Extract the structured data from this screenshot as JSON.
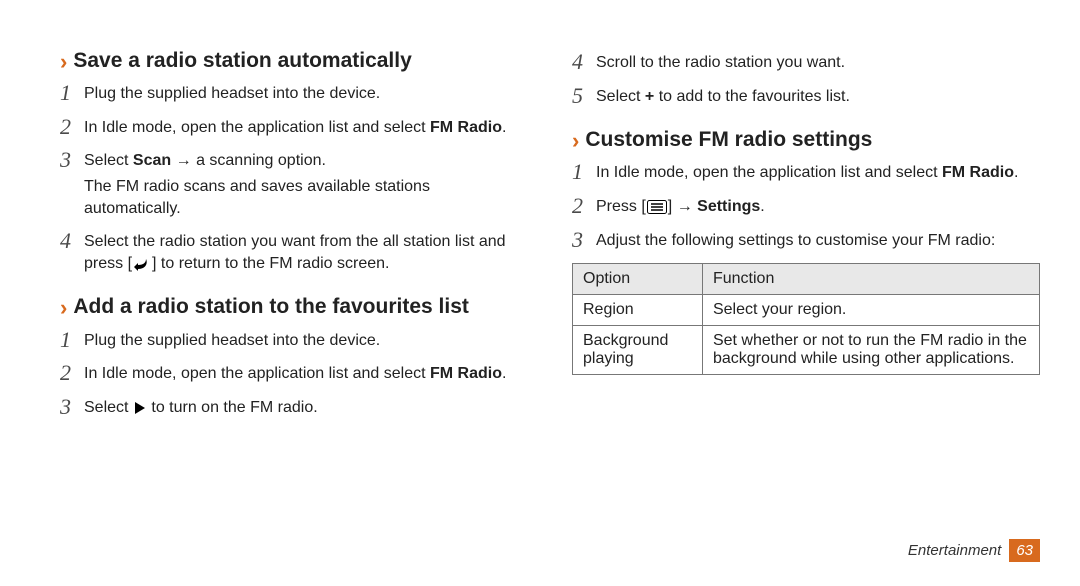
{
  "sections": {
    "save": {
      "title": "Save a radio station automatically",
      "steps": [
        {
          "n": "1",
          "lines": [
            "Plug the supplied headset into the device."
          ]
        },
        {
          "n": "2",
          "lines": [
            "In Idle mode, open the application list and select <b>FM Radio</b>."
          ]
        },
        {
          "n": "3",
          "lines": [
            "Select <b>Scan</b> → a scanning option.",
            "The FM radio scans and saves available stations automatically."
          ]
        },
        {
          "n": "4",
          "lines": [
            "Select the radio station you want from the all station list and press [BACK_ICON] to return to the FM radio screen."
          ]
        }
      ]
    },
    "fav": {
      "title": "Add a radio station to the favourites list",
      "steps": [
        {
          "n": "1",
          "lines": [
            "Plug the supplied headset into the device."
          ]
        },
        {
          "n": "2",
          "lines": [
            "In Idle mode, open the application list and select <b>FM Radio</b>."
          ]
        },
        {
          "n": "3",
          "lines": [
            "Select PLAY_ICON to turn on the FM radio."
          ]
        },
        {
          "n": "4",
          "lines": [
            "Scroll to the radio station you want."
          ]
        },
        {
          "n": "5",
          "lines": [
            "Select <b>+</b> to add to the favourites list."
          ]
        }
      ]
    },
    "cust": {
      "title": "Customise FM radio settings",
      "steps": [
        {
          "n": "1",
          "lines": [
            "In Idle mode, open the application list and select <b>FM Radio</b>."
          ]
        },
        {
          "n": "2",
          "lines": [
            "Press [MENU_ICON] → <b>Settings</b>."
          ]
        },
        {
          "n": "3",
          "lines": [
            "Adjust the following settings to customise your FM radio:"
          ]
        }
      ]
    }
  },
  "table": {
    "headers": [
      "Option",
      "Function"
    ],
    "rows": [
      [
        "Region",
        "Select your region."
      ],
      [
        "Background playing",
        "Set whether or not to run the FM radio in the background while using other applications."
      ]
    ]
  },
  "footer": {
    "section": "Entertainment",
    "page": "63"
  }
}
